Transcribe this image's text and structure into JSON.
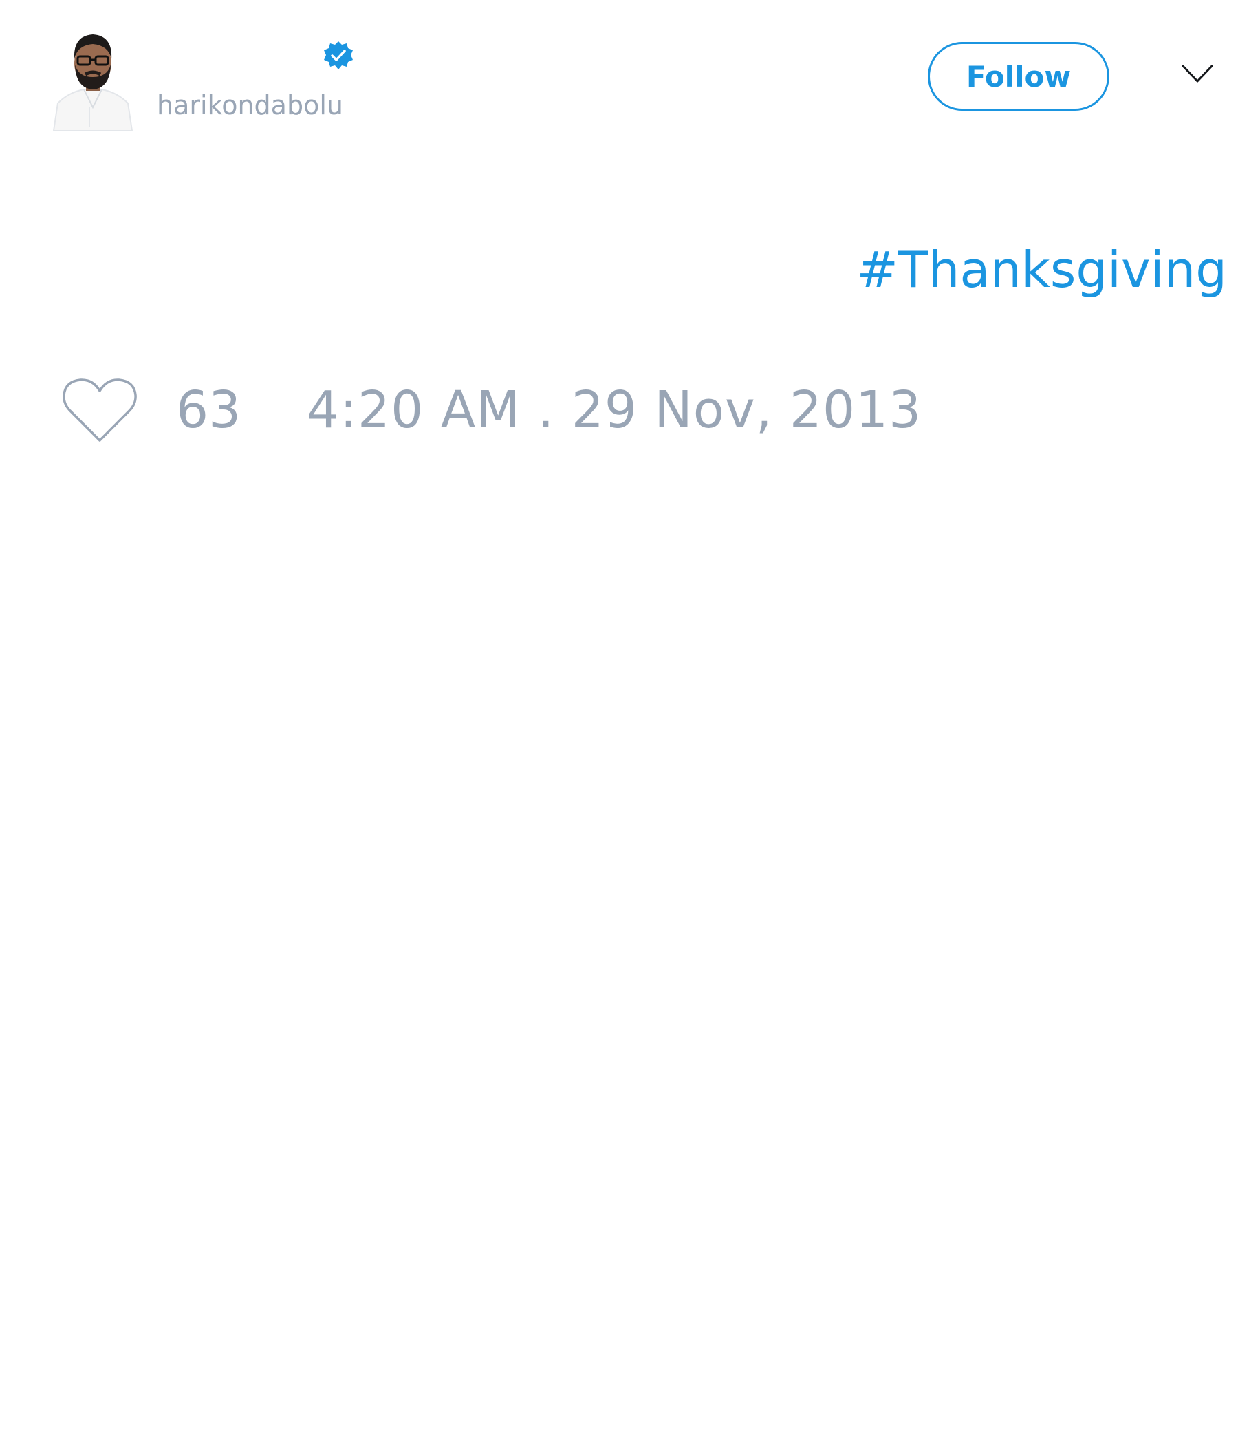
{
  "author": {
    "handle": "harikondabolu",
    "verified": true
  },
  "header": {
    "follow_label": "Follow"
  },
  "tweet": {
    "hashtag": "#Thanksgiving",
    "like_count": "63",
    "timestamp": "4:20 AM . 29 Nov, 2013"
  },
  "colors": {
    "accent": "#1b95e0",
    "muted": "#99a5b5"
  },
  "icons": {
    "verified": "verified-badge-icon",
    "menu": "chevron-down-icon",
    "like": "heart-icon"
  }
}
